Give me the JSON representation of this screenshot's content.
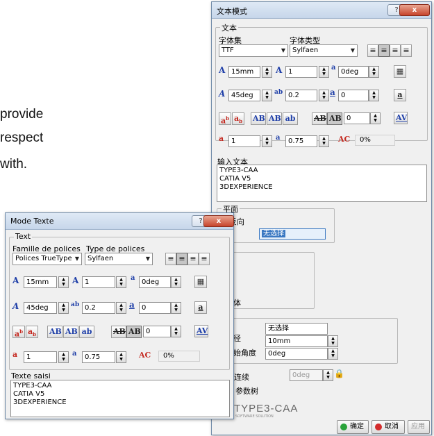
{
  "background": {
    "lines": [
      "provide",
      "respect",
      "with."
    ]
  },
  "dialog_cn": {
    "title": "文本模式",
    "help": "?",
    "close": "x",
    "text_group": "文本",
    "font_set_label": "字体集",
    "font_type_label": "字体类型",
    "font_set_value": "TTF",
    "font_type_value": "Sylfaen",
    "height_value": "15mm",
    "ratio_value": "1",
    "angle_value": "0deg",
    "slant_value": "45deg",
    "spacing_value": "0.2",
    "offset_value": "0",
    "kerning_value": "0",
    "line_spacing_value": "1",
    "line_ratio_value": "0.75",
    "percent": "0%",
    "input_text_label": "输入文本",
    "text_lines": [
      "TYPE3-CAA",
      "CATIA V5",
      "3DEXPERIENCE"
    ],
    "plane_group": "平面",
    "reverse_label": "翻反向",
    "selection_value": "无选择",
    "body_label": "体",
    "none_select": "无选择",
    "radius_label": "径",
    "radius_value": "10mm",
    "start_angle_label": "始角度",
    "start_angle_value": "0deg",
    "continuous_label": "连续",
    "continuous_value": "0deg",
    "params_label": "参数树",
    "brand": "TYPE3-CAA",
    "brand_sub": "SOFTWARE SOLUTION",
    "ok": "确定",
    "cancel": "取消",
    "apply": "应用"
  },
  "dialog_fr": {
    "title": "Mode Texte",
    "help": "?",
    "close": "x",
    "text_group": "Text",
    "font_family_label": "Famille de polices",
    "font_type_label": "Type de polices",
    "font_family_value": "Polices TrueType",
    "font_type_value": "Sylfaen",
    "height_value": "15mm",
    "ratio_value": "1",
    "angle_value": "0deg",
    "slant_value": "45deg",
    "spacing_value": "0.2",
    "offset_value": "0",
    "kerning_value": "0",
    "line_spacing_value": "1",
    "line_ratio_value": "0.75",
    "percent": "0%",
    "input_text_label": "Texte saisi",
    "text_lines": [
      "TYPE3-CAA",
      "CATIA V5",
      "3DEXPERIENCE"
    ]
  },
  "icons": {
    "height": "A",
    "ratio": "A",
    "angle": "a",
    "slant": "A",
    "spacing": "ab",
    "offset": "a",
    "super": "a",
    "sub": "a",
    "ab1": "AB",
    "ab2": "AB",
    "ab3": "ab",
    "ab4": "AB",
    "ab5": "AB",
    "av": "AV",
    "line_spacing": "a",
    "line_ratio": "a",
    "ac": "AC",
    "calc": "▦",
    "ul": "a"
  },
  "colors": {
    "accent": "#1f3fa8",
    "red": "#c4281f",
    "ok_dot": "#2aa33a",
    "cancel_dot": "#d32b2b"
  }
}
